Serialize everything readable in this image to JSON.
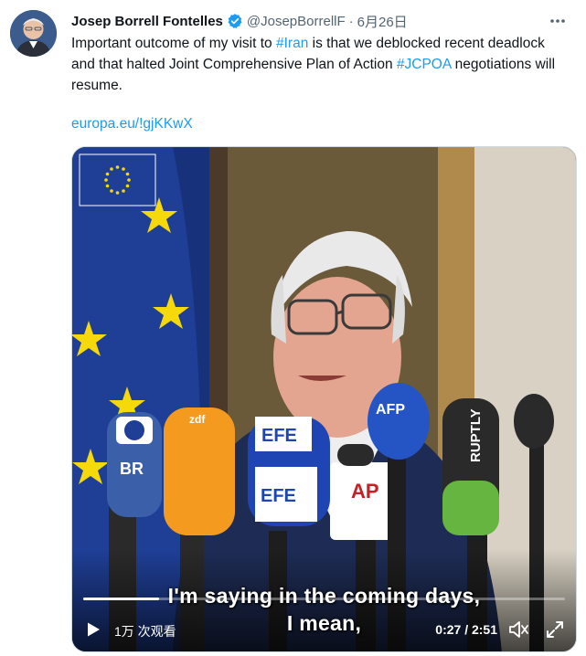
{
  "author": {
    "name": "Josep Borrell Fontelles",
    "handle": "@JosepBorrellF",
    "separator": "·",
    "date": "6月26日",
    "verified_icon": "verified-badge-icon"
  },
  "tweet": {
    "text_part1": "Important outcome of my visit to ",
    "hashtag1": "#Iran",
    "text_part2": " is that we deblocked recent deadlock and that halted Joint Comprehensive Plan of Action ",
    "hashtag2": "#JCPOA",
    "text_part3": " negotiations will resume.",
    "link": "europa.eu/!gjKKwX"
  },
  "video": {
    "caption_line1": "I'm saying in the coming days,",
    "caption_line2": "I mean,",
    "views": "1万 次观看",
    "time": "0:27 / 2:51",
    "progress_fraction": 0.158,
    "mic_labels": {
      "efe_top": "EFE",
      "efe_bottom": "EFE",
      "ap": "AP",
      "afp": "AFP",
      "ruptly": "RUPTLY",
      "br": "BR",
      "zdf": "zdf"
    }
  },
  "colors": {
    "accent": "#1d9bf0",
    "text": "#0f1419",
    "muted": "#536471",
    "eu_blue": "#1f3f97",
    "eu_star": "#f5d90a"
  }
}
